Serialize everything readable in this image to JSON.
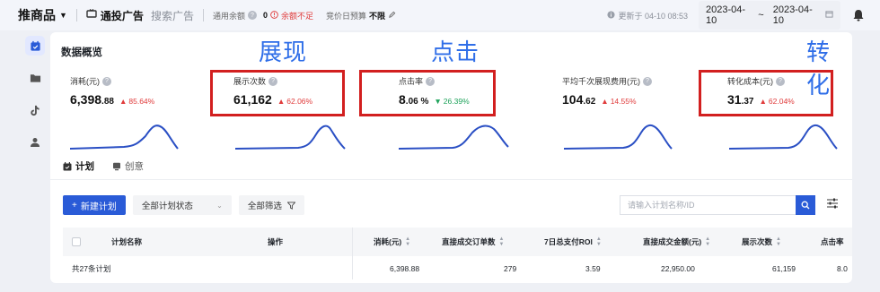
{
  "topbar": {
    "brand": "推商品",
    "tab_active": "通投广告",
    "tab_inactive": "搜索广告",
    "balance_label": "通用余额",
    "balance_value": "0",
    "balance_warning": "余额不足",
    "budget_label": "竞价日预算",
    "budget_value": "不限",
    "update_text": "更新于 04-10 08:53",
    "date_start": "2023-04-10",
    "date_sep": "~",
    "date_end": "2023-04-10"
  },
  "overview": {
    "title": "数据概览",
    "annotations": [
      "展现",
      "点击",
      "转化"
    ],
    "metrics": [
      {
        "label": "消耗(元)",
        "value": "6,398",
        "frac": ".88",
        "change": "85.64%",
        "direction": "up"
      },
      {
        "label": "展示次数",
        "value": "61,162",
        "frac": "",
        "change": "62.06%",
        "direction": "up"
      },
      {
        "label": "点击率",
        "value": "8",
        "frac": ".06 %",
        "change": "26.39%",
        "direction": "down"
      },
      {
        "label": "平均千次展现费用(元)",
        "value": "104",
        "frac": ".62",
        "change": "14.55%",
        "direction": "up"
      },
      {
        "label": "转化成本(元)",
        "value": "31",
        "frac": ".37",
        "change": "62.04%",
        "direction": "up"
      }
    ]
  },
  "tabs": [
    {
      "label": "计划",
      "icon": "calendar-icon"
    },
    {
      "label": "创意",
      "icon": "monitor-icon"
    }
  ],
  "toolbar": {
    "new_plan": "新建计划",
    "status_select": "全部计划状态",
    "filter": "全部筛选",
    "search_placeholder": "请输入计划名称/ID"
  },
  "table": {
    "columns": [
      "计划名称",
      "操作",
      "消耗(元)",
      "直接成交订单数",
      "7日总支付ROI",
      "直接成交金额(元)",
      "展示次数",
      "点击率"
    ],
    "summary_row": {
      "name": "共27条计划",
      "cost": "6,398.88",
      "orders": "279",
      "roi": "3.59",
      "amount": "22,950.00",
      "impressions": "61,159",
      "ctr": "8.0"
    }
  },
  "colors": {
    "accent": "#2a5bd7",
    "annotation": "#2f6ee8",
    "highlight_box": "#d21f1f",
    "up": "#e03b3b",
    "down": "#1fa35b"
  }
}
